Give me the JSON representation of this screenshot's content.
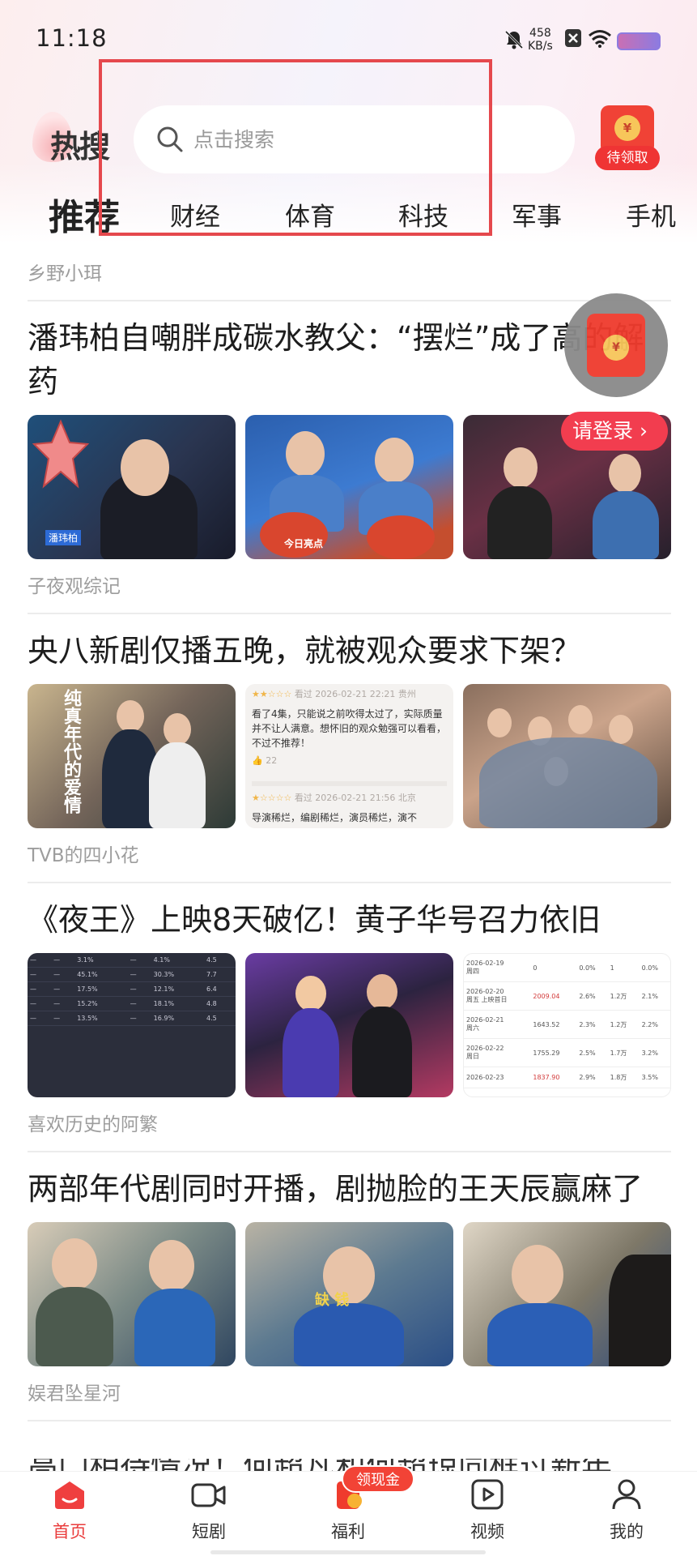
{
  "status_bar": {
    "time": "11:18",
    "net_speed_value": "458",
    "net_speed_unit": "KB/s"
  },
  "header": {
    "logo_text": "热搜",
    "search_placeholder": "点击搜索",
    "red_packet_label": "待领取"
  },
  "tabs": [
    {
      "label": "推荐",
      "active": true
    },
    {
      "label": "财经"
    },
    {
      "label": "体育"
    },
    {
      "label": "科技"
    },
    {
      "label": "军事"
    },
    {
      "label": "手机"
    }
  ],
  "feed": {
    "top_author": "乡野小珥",
    "articles": [
      {
        "title": "潘玮柏自嘲胖成碳水教父：“摆烂”成了高的解药",
        "author": "子夜观综记",
        "image_caption": "潘玮柏",
        "image_caption_2": "今日亮点"
      },
      {
        "title": "央八新剧仅播五晚，就被观众要求下架？",
        "author": "TVB的四小花",
        "poster_text": "纯真年代的爱情",
        "review1_meta": "看过  2026-02-21 22:21 贵州",
        "review1_text": "看了4集，只能说之前吹得太过了，实际质量并不让人满意。想怀旧的观众勉强可以看看，不过不推荐！",
        "review1_likes": "22",
        "review2_meta": "看过  2026-02-21 21:56 北京",
        "review2_text": "导演稀烂，编剧稀烂，演员稀烂，演不"
      },
      {
        "title": "《夜王》上映8天破亿！黄子华号召力依旧",
        "author": "喜欢历史的阿繁",
        "box_office_rows": [
          {
            "date": "2026-02-19",
            "day": "周四",
            "value": "0",
            "pct": "0.0%",
            "n": "1",
            "r": "0.0%"
          },
          {
            "date": "2026-02-20",
            "day": "周五 上映首日",
            "value": "2009.04",
            "pct": "2.6%",
            "n": "1.2万",
            "r": "2.1%"
          },
          {
            "date": "2026-02-21",
            "day": "周六",
            "value": "1643.52",
            "pct": "2.3%",
            "n": "1.2万",
            "r": "2.2%"
          },
          {
            "date": "2026-02-22",
            "day": "周日",
            "value": "1755.29",
            "pct": "2.5%",
            "n": "1.7万",
            "r": "3.2%"
          },
          {
            "date": "2026-02-23",
            "day": "",
            "value": "1837.90",
            "pct": "2.9%",
            "n": "1.8万",
            "r": "3.5%"
          }
        ]
      },
      {
        "title": "两部年代剧同时开播，剧抛脸的王天辰赢麻了",
        "author": "娱君坠星河",
        "image_caption": "缺        钱"
      }
    ],
    "partial_title": "高门相待情况！何超凡和何超琼同框过新年"
  },
  "floating": {
    "login_label": "请登录 ›"
  },
  "bottom_nav": [
    {
      "label": "首页",
      "icon": "home-icon",
      "active": true
    },
    {
      "label": "短剧",
      "icon": "video-camera-icon"
    },
    {
      "label": "福利",
      "icon": "gift-icon",
      "badge": "领现金"
    },
    {
      "label": "视频",
      "icon": "play-icon"
    },
    {
      "label": "我的",
      "icon": "profile-icon"
    }
  ],
  "colors": {
    "accent": "#ea3c3c",
    "highlight_box": "#e5484d"
  }
}
